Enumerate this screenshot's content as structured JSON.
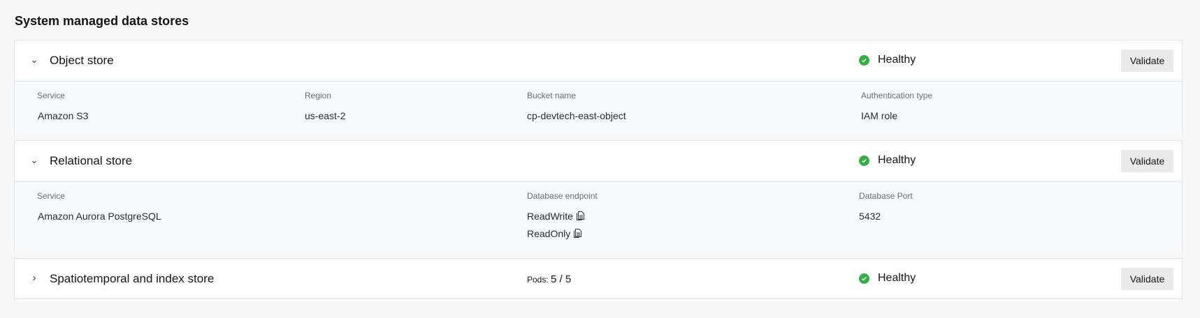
{
  "page_title": "System managed data stores",
  "status_color": "#35ac46",
  "stores": [
    {
      "name": "Object store",
      "expanded": true,
      "status": "Healthy",
      "validate_label": "Validate",
      "fields": [
        {
          "label": "Service",
          "value": "Amazon S3"
        },
        {
          "label": "Region",
          "value": "us-east-2"
        },
        {
          "label": "Bucket name",
          "value": "cp-devtech-east-object"
        },
        {
          "label": "Authentication type",
          "value": "IAM role"
        }
      ]
    },
    {
      "name": "Relational store",
      "expanded": true,
      "status": "Healthy",
      "validate_label": "Validate",
      "fields": [
        {
          "label": "Service",
          "value": "Amazon Aurora PostgreSQL"
        },
        {
          "label": "Database endpoint",
          "values": [
            "ReadWrite",
            "ReadOnly"
          ]
        },
        {
          "label": "Database Port",
          "value": "5432"
        }
      ]
    },
    {
      "name": "Spatiotemporal and index store",
      "expanded": false,
      "status": "Healthy",
      "validate_label": "Validate",
      "pods_label": "Pods:",
      "pods_value": "5 / 5"
    }
  ]
}
